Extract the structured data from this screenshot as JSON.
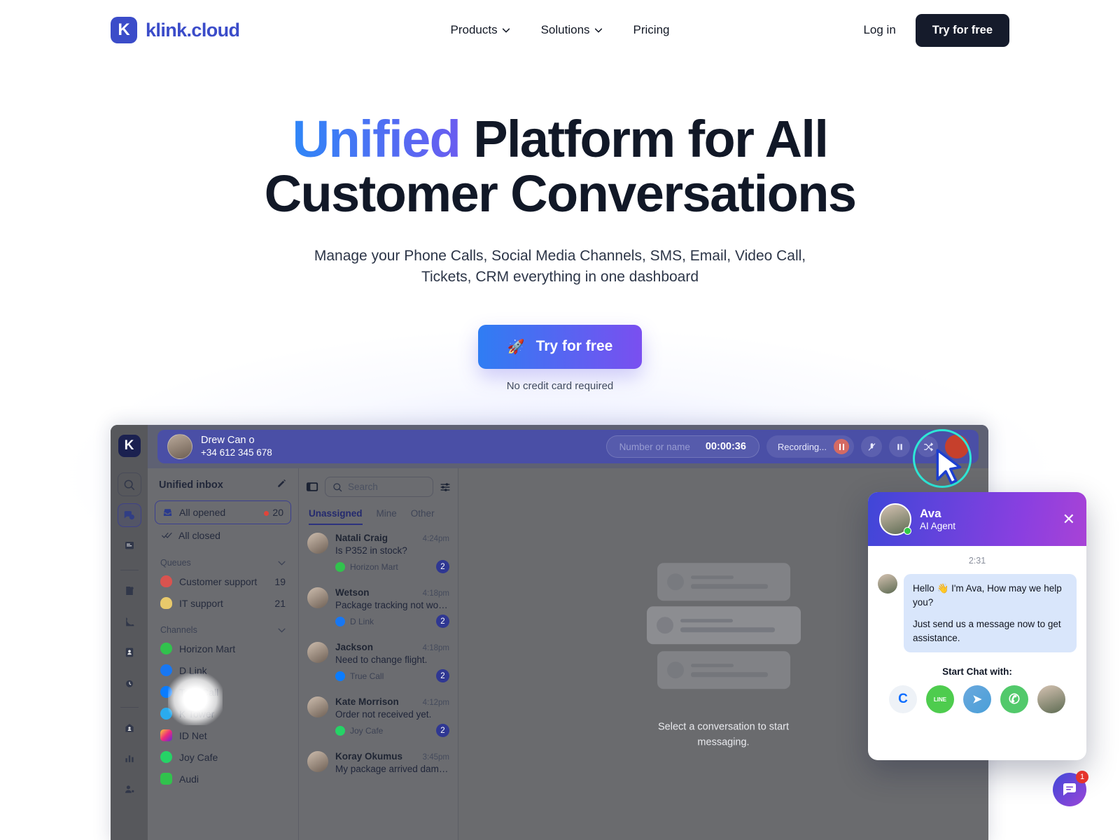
{
  "header": {
    "brand": {
      "mark": "K",
      "name": "klink.cloud"
    },
    "nav": [
      {
        "label": "Products",
        "has_chevron": true
      },
      {
        "label": "Solutions",
        "has_chevron": true
      },
      {
        "label": "Pricing",
        "has_chevron": false
      }
    ],
    "login_label": "Log in",
    "cta_label": "Try for free"
  },
  "hero": {
    "headline_accent": "Unified",
    "headline_rest": " Platform for All",
    "headline_line2": "Customer Conversations",
    "subtitle_line1": "Manage your Phone Calls, Social Media Channels, SMS, Email, Video Call,",
    "subtitle_line2": "Tickets, CRM everything in one dashboard",
    "cta_label": "Try for free",
    "cta_icon": "rocket-icon",
    "note": "No credit card required"
  },
  "app": {
    "rail": [
      {
        "name": "search-icon"
      },
      {
        "name": "chat-icon",
        "active": true
      },
      {
        "name": "notes-icon"
      },
      {
        "name": "file-icon"
      },
      {
        "name": "phone-icon"
      },
      {
        "name": "contacts-icon"
      },
      {
        "name": "alarm-icon"
      },
      {
        "name": "home-icon"
      },
      {
        "name": "analytics-icon"
      },
      {
        "name": "team-icon"
      }
    ],
    "logo_letter": "K",
    "call_bar": {
      "contact_name": "Drew Can o",
      "contact_phone": "+34 612 345 678",
      "number_placeholder": "Number or name",
      "timer": "00:00:36",
      "recording_label": "Recording...",
      "controls": [
        "mute-icon",
        "pause-icon",
        "transfer-icon",
        "end-call-icon"
      ]
    },
    "inbox": {
      "title": "Unified inbox",
      "compose_icon": "compose-icon",
      "all_opened": {
        "label": "All opened",
        "count": "20"
      },
      "all_closed": {
        "label": "All closed"
      },
      "queues_label": "Queues",
      "queues": [
        {
          "label": "Customer support",
          "count": "19",
          "color": "#d9534f"
        },
        {
          "label": "IT support",
          "count": "21",
          "color": "#e8c96b"
        }
      ],
      "channels_label": "Channels",
      "channels": [
        {
          "label": "Horizon Mart",
          "color": "#31c24d"
        },
        {
          "label": "D Link",
          "color": "#1877f2"
        },
        {
          "label": "True Call",
          "color": "#0a7cff"
        },
        {
          "label": "K Tower",
          "color": "#2aabee"
        },
        {
          "label": "ID Net",
          "color": "#d62976"
        },
        {
          "label": "Joy Cafe",
          "color": "#25d366"
        },
        {
          "label": "Audi",
          "color": "#31c24d"
        }
      ]
    },
    "list": {
      "search_placeholder": "Search",
      "panel_icon": "panel-toggle-icon",
      "filter_icon": "filter-icon",
      "tabs": [
        {
          "label": "Unassigned",
          "active": true
        },
        {
          "label": "Mine",
          "active": false
        },
        {
          "label": "Other",
          "active": false
        }
      ],
      "conversations": [
        {
          "name": "Natali Craig",
          "time": "4:24pm",
          "message": "Is P352 in stock?",
          "channel": "Horizon Mart",
          "channel_color": "#31c24d",
          "badge": "2"
        },
        {
          "name": "Wetson",
          "time": "4:18pm",
          "message": "Package tracking not worki...",
          "channel": "D Link",
          "channel_color": "#1877f2",
          "badge": "2"
        },
        {
          "name": "Jackson",
          "time": "4:18pm",
          "message": "Need to change flight.",
          "channel": "True Call",
          "channel_color": "#0a7cff",
          "badge": "2"
        },
        {
          "name": "Kate Morrison",
          "time": "4:12pm",
          "message": "Order not received yet.",
          "channel": "Joy Cafe",
          "channel_color": "#25d366",
          "badge": "2"
        },
        {
          "name": "Koray Okumus",
          "time": "3:45pm",
          "message": "My package arrived damag...",
          "channel": "",
          "channel_color": "#31c24d",
          "badge": ""
        }
      ]
    },
    "empty_state": {
      "line1": "Select a conversation to start",
      "line2": "messaging."
    }
  },
  "chat_widget": {
    "agent_name": "Ava",
    "agent_role": "AI Agent",
    "close_icon": "close-icon",
    "timestamp": "2:31",
    "message_1": "Hello 👋 I'm Ava, How may we help you?",
    "message_2": "Just send us a message now to get assistance.",
    "start_label": "Start Chat with:",
    "channels": [
      {
        "name": "klink-icon",
        "glyph": "C",
        "color": "#eef2f7",
        "fg": "#0a6cff"
      },
      {
        "name": "line-icon",
        "glyph": "LINE",
        "color": "#4ecc4e",
        "fg": "#ffffff"
      },
      {
        "name": "telegram-icon",
        "glyph": "➤",
        "color": "#4a9fd8",
        "fg": "#ffffff"
      },
      {
        "name": "whatsapp-icon",
        "glyph": "✆",
        "color": "#52c96b",
        "fg": "#ffffff"
      },
      {
        "name": "agent-avatar-icon",
        "glyph": "",
        "color": "#c9bdb2",
        "fg": "#ffffff"
      }
    ],
    "fab_badge": "1",
    "fab_icon": "chat-bubble-icon"
  },
  "colors": {
    "brand": "#3B4CC9",
    "accent_gradient_start": "#2f7df3",
    "accent_gradient_end": "#7a4ff0",
    "dark": "#151b2b",
    "highlight_ring": "#2ee6d6",
    "badge_red": "#e5342b"
  }
}
